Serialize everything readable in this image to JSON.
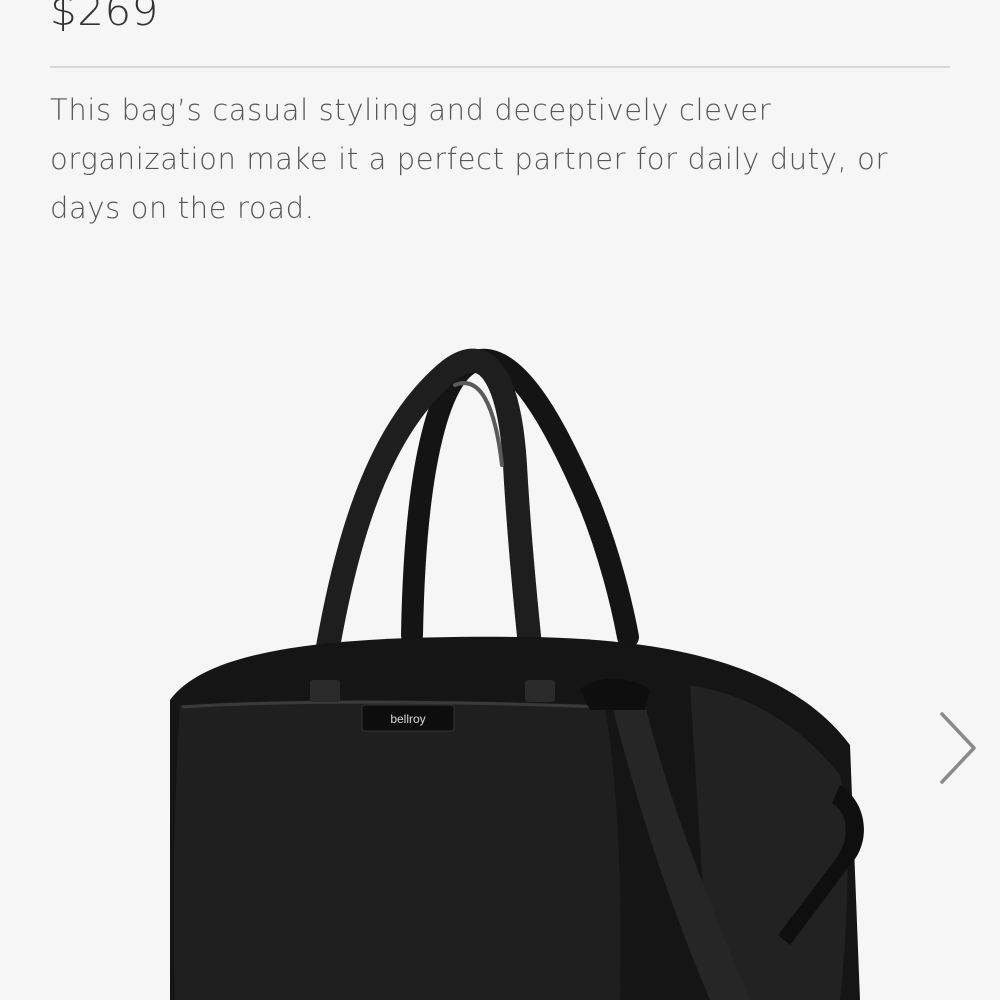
{
  "product": {
    "price": "$269",
    "description": "This bag’s casual styling and deceptively clever organization make it a perfect partner for daily duty, or days on the road.",
    "brand_tag": "bellroy"
  },
  "carousel": {
    "next_icon": "chevron-right-icon"
  },
  "colors": {
    "background": "#f6f6f6",
    "bag": "#1c1c1c",
    "arrow": "#8a8a8a"
  }
}
